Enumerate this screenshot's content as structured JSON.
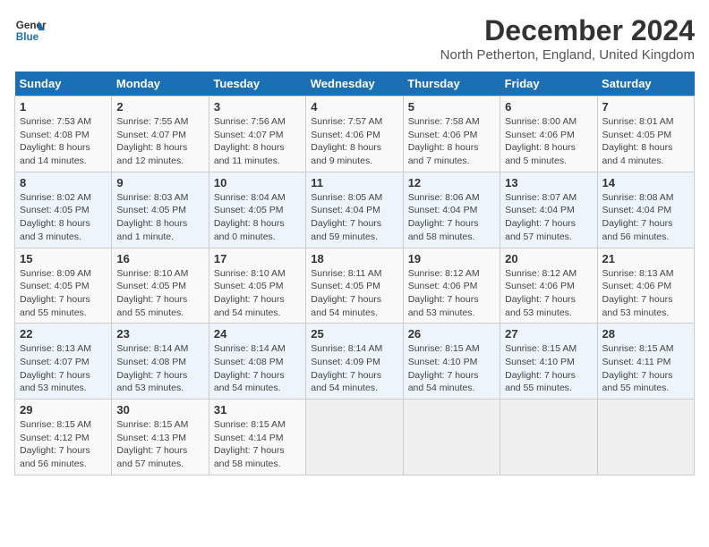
{
  "header": {
    "logo_line1": "General",
    "logo_line2": "Blue",
    "title": "December 2024",
    "subtitle": "North Petherton, England, United Kingdom"
  },
  "columns": [
    "Sunday",
    "Monday",
    "Tuesday",
    "Wednesday",
    "Thursday",
    "Friday",
    "Saturday"
  ],
  "weeks": [
    [
      {
        "day": "1",
        "sunrise": "7:53 AM",
        "sunset": "4:08 PM",
        "daylight": "8 hours and 14 minutes."
      },
      {
        "day": "2",
        "sunrise": "7:55 AM",
        "sunset": "4:07 PM",
        "daylight": "8 hours and 12 minutes."
      },
      {
        "day": "3",
        "sunrise": "7:56 AM",
        "sunset": "4:07 PM",
        "daylight": "8 hours and 11 minutes."
      },
      {
        "day": "4",
        "sunrise": "7:57 AM",
        "sunset": "4:06 PM",
        "daylight": "8 hours and 9 minutes."
      },
      {
        "day": "5",
        "sunrise": "7:58 AM",
        "sunset": "4:06 PM",
        "daylight": "8 hours and 7 minutes."
      },
      {
        "day": "6",
        "sunrise": "8:00 AM",
        "sunset": "4:06 PM",
        "daylight": "8 hours and 5 minutes."
      },
      {
        "day": "7",
        "sunrise": "8:01 AM",
        "sunset": "4:05 PM",
        "daylight": "8 hours and 4 minutes."
      }
    ],
    [
      {
        "day": "8",
        "sunrise": "8:02 AM",
        "sunset": "4:05 PM",
        "daylight": "8 hours and 3 minutes."
      },
      {
        "day": "9",
        "sunrise": "8:03 AM",
        "sunset": "4:05 PM",
        "daylight": "8 hours and 1 minute."
      },
      {
        "day": "10",
        "sunrise": "8:04 AM",
        "sunset": "4:05 PM",
        "daylight": "8 hours and 0 minutes."
      },
      {
        "day": "11",
        "sunrise": "8:05 AM",
        "sunset": "4:04 PM",
        "daylight": "7 hours and 59 minutes."
      },
      {
        "day": "12",
        "sunrise": "8:06 AM",
        "sunset": "4:04 PM",
        "daylight": "7 hours and 58 minutes."
      },
      {
        "day": "13",
        "sunrise": "8:07 AM",
        "sunset": "4:04 PM",
        "daylight": "7 hours and 57 minutes."
      },
      {
        "day": "14",
        "sunrise": "8:08 AM",
        "sunset": "4:04 PM",
        "daylight": "7 hours and 56 minutes."
      }
    ],
    [
      {
        "day": "15",
        "sunrise": "8:09 AM",
        "sunset": "4:05 PM",
        "daylight": "7 hours and 55 minutes."
      },
      {
        "day": "16",
        "sunrise": "8:10 AM",
        "sunset": "4:05 PM",
        "daylight": "7 hours and 55 minutes."
      },
      {
        "day": "17",
        "sunrise": "8:10 AM",
        "sunset": "4:05 PM",
        "daylight": "7 hours and 54 minutes."
      },
      {
        "day": "18",
        "sunrise": "8:11 AM",
        "sunset": "4:05 PM",
        "daylight": "7 hours and 54 minutes."
      },
      {
        "day": "19",
        "sunrise": "8:12 AM",
        "sunset": "4:06 PM",
        "daylight": "7 hours and 53 minutes."
      },
      {
        "day": "20",
        "sunrise": "8:12 AM",
        "sunset": "4:06 PM",
        "daylight": "7 hours and 53 minutes."
      },
      {
        "day": "21",
        "sunrise": "8:13 AM",
        "sunset": "4:06 PM",
        "daylight": "7 hours and 53 minutes."
      }
    ],
    [
      {
        "day": "22",
        "sunrise": "8:13 AM",
        "sunset": "4:07 PM",
        "daylight": "7 hours and 53 minutes."
      },
      {
        "day": "23",
        "sunrise": "8:14 AM",
        "sunset": "4:08 PM",
        "daylight": "7 hours and 53 minutes."
      },
      {
        "day": "24",
        "sunrise": "8:14 AM",
        "sunset": "4:08 PM",
        "daylight": "7 hours and 54 minutes."
      },
      {
        "day": "25",
        "sunrise": "8:14 AM",
        "sunset": "4:09 PM",
        "daylight": "7 hours and 54 minutes."
      },
      {
        "day": "26",
        "sunrise": "8:15 AM",
        "sunset": "4:10 PM",
        "daylight": "7 hours and 54 minutes."
      },
      {
        "day": "27",
        "sunrise": "8:15 AM",
        "sunset": "4:10 PM",
        "daylight": "7 hours and 55 minutes."
      },
      {
        "day": "28",
        "sunrise": "8:15 AM",
        "sunset": "4:11 PM",
        "daylight": "7 hours and 55 minutes."
      }
    ],
    [
      {
        "day": "29",
        "sunrise": "8:15 AM",
        "sunset": "4:12 PM",
        "daylight": "7 hours and 56 minutes."
      },
      {
        "day": "30",
        "sunrise": "8:15 AM",
        "sunset": "4:13 PM",
        "daylight": "7 hours and 57 minutes."
      },
      {
        "day": "31",
        "sunrise": "8:15 AM",
        "sunset": "4:14 PM",
        "daylight": "7 hours and 58 minutes."
      },
      null,
      null,
      null,
      null
    ]
  ]
}
